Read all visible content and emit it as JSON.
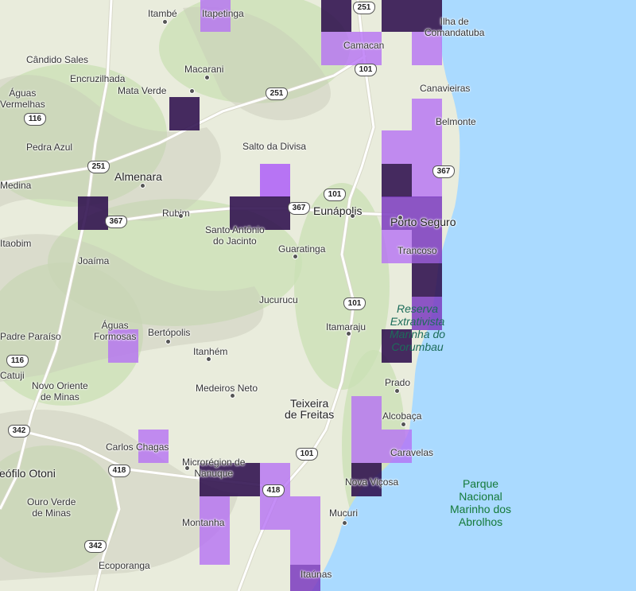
{
  "colors": {
    "ocean": "#aadaff",
    "land": "#e9ecdc",
    "forest": "#c9e0b4",
    "relief": "#c8c9b8",
    "road": "#ffffff",
    "road_outline": "#d8d8c8",
    "heat_light": "#b56ef5",
    "heat_mid": "#7b3bbf",
    "heat_dark": "#2e0f4d"
  },
  "places": [
    {
      "id": "itambe",
      "label": "Itambé"
    },
    {
      "id": "itapetinga",
      "label": "Itapetinga"
    },
    {
      "id": "ilha-de-comandatuba",
      "label": "Ilha de Comandatuba"
    },
    {
      "id": "candido-sales",
      "label": "Cândido Sales"
    },
    {
      "id": "macarani",
      "label": "Macarani"
    },
    {
      "id": "camacan",
      "label": "Camacan"
    },
    {
      "id": "encruzilhada",
      "label": "Encruzilhada"
    },
    {
      "id": "aguas-vermelhas",
      "label": "Águas Vermelhas"
    },
    {
      "id": "mata-verde",
      "label": "Mata Verde"
    },
    {
      "id": "canavieiras",
      "label": "Canavieiras"
    },
    {
      "id": "belmonte",
      "label": "Belmonte"
    },
    {
      "id": "pedra-azul",
      "label": "Pedra Azul"
    },
    {
      "id": "salto-da-divisa",
      "label": "Salto da Divisa"
    },
    {
      "id": "almenara",
      "label": "Almenara"
    },
    {
      "id": "medina",
      "label": "Medina"
    },
    {
      "id": "rubim",
      "label": "Rubim"
    },
    {
      "id": "eunapolis",
      "label": "Eunápolis"
    },
    {
      "id": "porto-seguro",
      "label": "Porto Seguro"
    },
    {
      "id": "santo-antonio-do-jacinto",
      "label": "Santo Antônio do Jacinto"
    },
    {
      "id": "itaobim",
      "label": "Itaobim"
    },
    {
      "id": "joaima",
      "label": "Joaíma"
    },
    {
      "id": "guaratinga",
      "label": "Guaratinga"
    },
    {
      "id": "trancoso",
      "label": "Trancoso"
    },
    {
      "id": "jucurucu",
      "label": "Jucurucu"
    },
    {
      "id": "aguas-formosas",
      "label": "Águas Formosas"
    },
    {
      "id": "bertopolis",
      "label": "Bertópolis"
    },
    {
      "id": "itamaraju",
      "label": "Itamaraju"
    },
    {
      "id": "padre-paraiso",
      "label": "Padre Paraíso"
    },
    {
      "id": "itanhem",
      "label": "Itanhém"
    },
    {
      "id": "catuji",
      "label": "Catuji"
    },
    {
      "id": "novo-oriente-de-minas",
      "label": "Novo Oriente de Minas"
    },
    {
      "id": "medeiros-neto",
      "label": "Medeiros Neto"
    },
    {
      "id": "prado",
      "label": "Prado"
    },
    {
      "id": "teixeira-de-freitas",
      "label": "Teixeira de Freitas"
    },
    {
      "id": "alcobaca",
      "label": "Alcobaça"
    },
    {
      "id": "carlos-chagas",
      "label": "Carlos Chagas"
    },
    {
      "id": "caravelas",
      "label": "Caravelas"
    },
    {
      "id": "microrregiao-de-nanuque",
      "label": "Microrégion de Nanuque"
    },
    {
      "id": "teofilo-otoni",
      "label": "Teófilo Otoni"
    },
    {
      "id": "nova-vicosa",
      "label": "Nova Viçosa"
    },
    {
      "id": "ouro-verde-de-minas",
      "label": "Ouro Verde de Minas"
    },
    {
      "id": "mucuri",
      "label": "Mucuri"
    },
    {
      "id": "montanha",
      "label": "Montanha"
    },
    {
      "id": "ecoporanga",
      "label": "Ecoporanga"
    },
    {
      "id": "itaunas",
      "label": "Itaúnas"
    }
  ],
  "water_labels": [
    {
      "id": "reserva-corumbau",
      "label": "Reserva Extrativista Marinha do Corumbau"
    }
  ],
  "parks": [
    {
      "id": "abrolhos",
      "label": "Parque Nacional Marinho dos Abrolhos"
    }
  ],
  "highways": [
    {
      "id": "br-251-north",
      "label": "251"
    },
    {
      "id": "br-101-camacan",
      "label": "101"
    },
    {
      "id": "br-251-mid",
      "label": "251"
    },
    {
      "id": "br-116-north",
      "label": "116"
    },
    {
      "id": "br-251-west",
      "label": "251"
    },
    {
      "id": "br-367-east",
      "label": "367"
    },
    {
      "id": "br-101-eunapolis",
      "label": "101"
    },
    {
      "id": "br-367-almenara",
      "label": "367"
    },
    {
      "id": "br-367-santo-antonio",
      "label": "367"
    },
    {
      "id": "br-101-itamaraju",
      "label": "101"
    },
    {
      "id": "br-116-south",
      "label": "116"
    },
    {
      "id": "br-342-west",
      "label": "342"
    },
    {
      "id": "br-418-chagas",
      "label": "418"
    },
    {
      "id": "br-101-teixeira",
      "label": "101"
    },
    {
      "id": "br-418-nanuque",
      "label": "418"
    },
    {
      "id": "br-342-south",
      "label": "342"
    }
  ],
  "heatmap_cells": [
    {
      "id": "itapetinga",
      "level": "light"
    },
    {
      "id": "camacan-top",
      "level": "dark"
    },
    {
      "id": "br251-top",
      "level": "dark"
    },
    {
      "id": "comandatuba-top",
      "level": "dark"
    },
    {
      "id": "camacan",
      "level": "light"
    },
    {
      "id": "camacan-east",
      "level": "light"
    },
    {
      "id": "comandatuba",
      "level": "light"
    },
    {
      "id": "mata-verde",
      "level": "dark"
    },
    {
      "id": "belmonte-1",
      "level": "light"
    },
    {
      "id": "belmonte-2",
      "level": "light"
    },
    {
      "id": "belmonte-3",
      "level": "light"
    },
    {
      "id": "belmonte-4",
      "level": "light"
    },
    {
      "id": "belmonte-5",
      "level": "dark"
    },
    {
      "id": "belmonte-6",
      "level": "light"
    },
    {
      "id": "salto-da-divisa",
      "level": "light"
    },
    {
      "id": "almenara-west",
      "level": "dark"
    },
    {
      "id": "santo-antonio-1",
      "level": "dark"
    },
    {
      "id": "santo-antonio-2",
      "level": "dark"
    },
    {
      "id": "porto-seguro-1",
      "level": "mid"
    },
    {
      "id": "porto-seguro-2",
      "level": "mid"
    },
    {
      "id": "trancoso-1",
      "level": "light"
    },
    {
      "id": "trancoso-2",
      "level": "mid"
    },
    {
      "id": "trancoso-3",
      "level": "dark"
    },
    {
      "id": "corumbau-1",
      "level": "mid"
    },
    {
      "id": "corumbau-2",
      "level": "dark"
    },
    {
      "id": "aguas-formosas",
      "level": "light"
    },
    {
      "id": "teixeira-1",
      "level": "light"
    },
    {
      "id": "teixeira-2",
      "level": "light"
    },
    {
      "id": "caravelas",
      "level": "light"
    },
    {
      "id": "carlos-chagas",
      "level": "light"
    },
    {
      "id": "nanuque-1",
      "level": "dark"
    },
    {
      "id": "nanuque-2",
      "level": "dark"
    },
    {
      "id": "nanuque-3",
      "level": "light"
    },
    {
      "id": "nova-vicosa",
      "level": "dark"
    },
    {
      "id": "montanha-1",
      "level": "light"
    },
    {
      "id": "montanha-2",
      "level": "light"
    },
    {
      "id": "mucuri-1",
      "level": "light"
    },
    {
      "id": "mucuri-2",
      "level": "light"
    },
    {
      "id": "mucuri-3",
      "level": "light"
    },
    {
      "id": "itaunas",
      "level": "mid"
    }
  ]
}
